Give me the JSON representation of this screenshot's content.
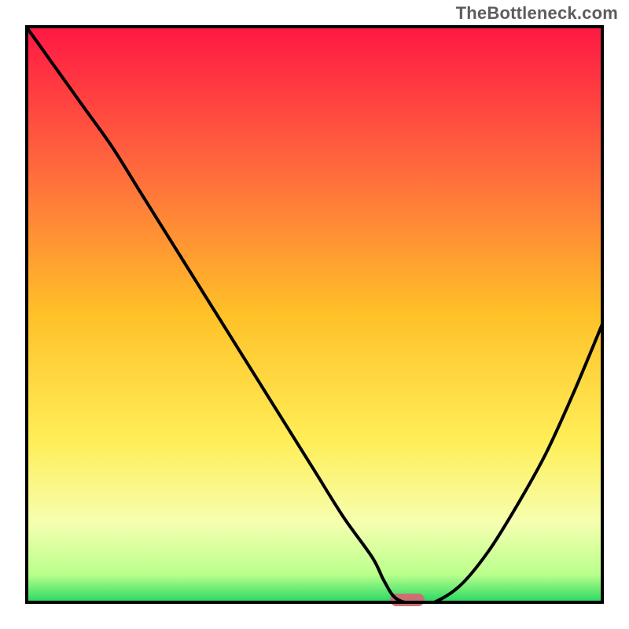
{
  "watermark": "TheBottleneck.com",
  "chart_data": {
    "type": "line",
    "title": "",
    "xlabel": "",
    "ylabel": "",
    "xlim": [
      0,
      100
    ],
    "ylim": [
      0,
      100
    ],
    "grid": false,
    "legend": false,
    "x": [
      0,
      5,
      10,
      15,
      20,
      25,
      30,
      35,
      40,
      45,
      50,
      55,
      60,
      62,
      64,
      67,
      70,
      75,
      80,
      85,
      90,
      95,
      100
    ],
    "values": [
      100,
      93,
      86,
      79,
      71,
      63,
      55,
      47,
      39,
      31,
      23,
      15,
      8,
      4,
      1,
      0,
      0,
      3,
      9,
      17,
      26,
      37,
      49
    ],
    "background_gradient_stops": [
      {
        "pct": 0,
        "color": "#ff1744"
      },
      {
        "pct": 25,
        "color": "#ff6a3d"
      },
      {
        "pct": 50,
        "color": "#ffc128"
      },
      {
        "pct": 72,
        "color": "#ffee58"
      },
      {
        "pct": 86,
        "color": "#f6ffb0"
      },
      {
        "pct": 95,
        "color": "#b9ff8c"
      },
      {
        "pct": 100,
        "color": "#1dd65f"
      }
    ],
    "marker": {
      "x_center_pct": 66,
      "y_pct": 0,
      "width_pct": 6,
      "color": "#cc6f72"
    }
  }
}
